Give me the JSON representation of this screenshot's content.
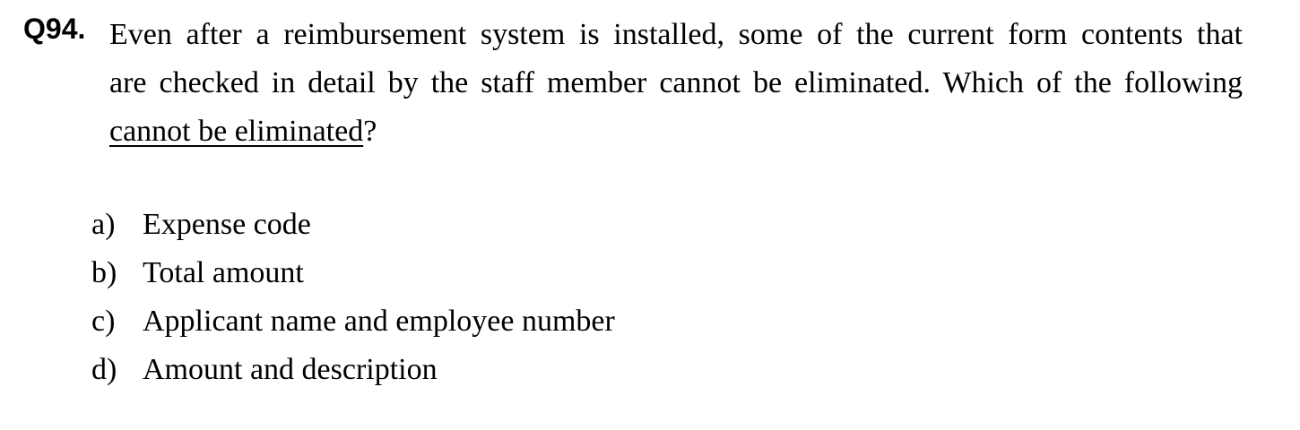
{
  "question": {
    "number": "Q94.",
    "lines": [
      "Even after a reimbursement system is installed, some of the current form contents that",
      "are checked in detail by the staff member cannot be eliminated. Which of the following"
    ],
    "underlined_phrase": "cannot be eliminated",
    "trailing_punctuation": "?"
  },
  "options": [
    {
      "letter": "a)",
      "text": "Expense code"
    },
    {
      "letter": "b)",
      "text": "Total amount"
    },
    {
      "letter": "c)",
      "text": "Applicant name and employee number"
    },
    {
      "letter": "d)",
      "text": "Amount and description"
    }
  ]
}
